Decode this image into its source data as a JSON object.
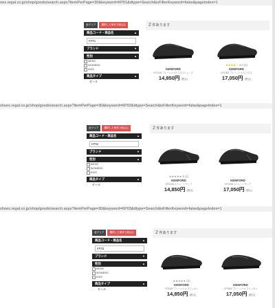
{
  "shots": [
    {
      "url": "oes.regal.co.jp/shop/goods/search.aspx?itemPerPage=30&keyword=KP01&dtype=Search&isFilterKeyword=false&pageIndex=1",
      "clear_label": "全クリア",
      "cond_label": "選択した条件で絞込む",
      "search_header": "商品コード・商品名",
      "search_value": "KP01",
      "brand_header": "ブランド",
      "gender_header": "性別",
      "genders": [
        "MENS",
        "WOMENS",
        "KIDS"
      ],
      "type_header": "商品タイプ",
      "sale_label": "セール",
      "count_num": "2",
      "count_text": "件あります",
      "products": [
        {
          "rating": "",
          "stars": "",
          "brand": "KENFORD",
          "desc": "KP01AB プレーントゥビジネスシューズ",
          "price": "14,850円",
          "tax": "(税込)"
        },
        {
          "rating": "4.0",
          "stars": "★★★★☆",
          "reviews": "(2)",
          "brand": "KENFORD",
          "desc": "KP01BB プレーントゥ ビジネス",
          "price": "17,050円",
          "tax": "(税込)"
        }
      ]
    },
    {
      "url": "shoes.regal.co.jp/shop/goods/search.aspx?itemPerPage=30&keyword=KP02&dtype=Search&isFilterKeyword=false&pageIndex=1",
      "clear_label": "全クリア",
      "cond_label": "選択した条件で絞込む",
      "search_header": "商品コード・商品名",
      "search_value": "KP02",
      "brand_header": "ブランド",
      "gender_header": "性別",
      "genders": [
        "MENS",
        "WOMENS",
        "KIDS"
      ],
      "type_header": "商品タイプ",
      "sale_label": "セール",
      "count_num": "2",
      "count_text": "件あります",
      "products": [
        {
          "rating": "5",
          "stars": "★★★★★",
          "reviews": "(1)",
          "brand": "KENFORD",
          "desc": "KP02AB ストレートチップ",
          "price": "14,850円",
          "tax": "(税込)"
        },
        {
          "rating": "",
          "stars": "",
          "brand": "KENFORD",
          "desc": "KP02BB ストレートチップ",
          "price": "17,050円",
          "tax": "(税込)"
        }
      ]
    },
    {
      "url": "shoes.regal.co.jp/shop/goods/search.aspx?itemPerPage=30&keyword=KP03&dtype=Search&isFilterKeyword=false&pageIndex=1",
      "clear_label": "全クリア",
      "cond_label": "選択した条件で絞込む",
      "search_header": "商品コード・商品名",
      "search_value": "KP03",
      "brand_header": "ブランド",
      "gender_header": "性別",
      "genders": [
        "MENS",
        "WOMENS",
        "KIDS"
      ],
      "type_header": "商品タイプ",
      "sale_label": "セール",
      "count_num": "2",
      "count_text": "件あります",
      "products": [
        {
          "rating": "",
          "stars": "★★★★★",
          "reviews": "(2)",
          "brand": "KENFORD",
          "desc": "KP03AB プレーントゥ スリッポン",
          "price": "14,850円",
          "tax": "(税込)"
        },
        {
          "rating": "",
          "stars": "",
          "brand": "KENFORD",
          "desc": "KP03BB プレーントゥ スリッポン",
          "price": "17,050円",
          "tax": "(税込)"
        }
      ]
    }
  ],
  "colors": {
    "header": "#222222",
    "clear": "#444444",
    "cond": "#d9534f",
    "star": "#e8a700"
  }
}
